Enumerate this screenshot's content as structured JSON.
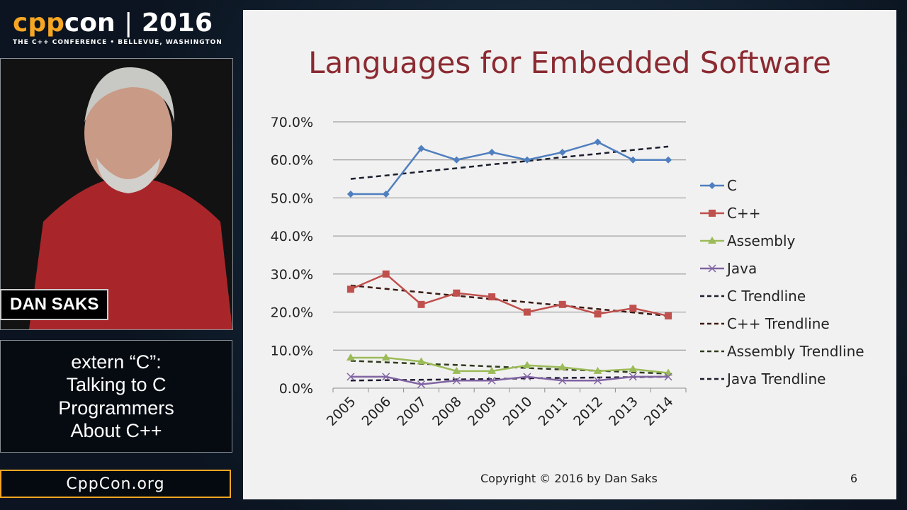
{
  "branding": {
    "logo_cpp": "cpp",
    "logo_con": "con",
    "logo_sep": "|",
    "logo_year": "2016",
    "tagline": "THE C++ CONFERENCE • BELLEVUE, WASHINGTON",
    "site": "CppCon.org"
  },
  "speaker": {
    "name": "DAN SAKS"
  },
  "talk": {
    "title_lines": [
      "extern “C”:",
      "Talking to C",
      "Programmers",
      "About C++"
    ]
  },
  "slide": {
    "title": "Languages for Embedded Software",
    "copyright": "Copyright © 2016 by Dan Saks",
    "page": "6"
  },
  "chart_data": {
    "type": "line",
    "title": "Languages for Embedded Software",
    "x": [
      "2005",
      "2006",
      "2007",
      "2008",
      "2009",
      "2010",
      "2011",
      "2012",
      "2013",
      "2014"
    ],
    "ylim": [
      0,
      70
    ],
    "yticks": [
      "0.0%",
      "10.0%",
      "20.0%",
      "30.0%",
      "40.0%",
      "50.0%",
      "60.0%",
      "70.0%"
    ],
    "grid": true,
    "legend": "right",
    "series": [
      {
        "name": "C",
        "color": "#4f7fbf",
        "marker": "diamond",
        "values": [
          51,
          51,
          63,
          60,
          62,
          60,
          62,
          64.7,
          60,
          60
        ]
      },
      {
        "name": "C++",
        "color": "#c0504d",
        "marker": "square",
        "values": [
          26,
          30,
          22,
          25,
          24,
          20,
          22,
          19.5,
          21,
          19
        ]
      },
      {
        "name": "Assembly",
        "color": "#9bbb59",
        "marker": "triangle",
        "values": [
          8,
          8,
          7,
          4.5,
          4.5,
          6,
          5.5,
          4.5,
          5,
          4
        ]
      },
      {
        "name": "Java",
        "color": "#8064a2",
        "marker": "x",
        "values": [
          3,
          3,
          1,
          2,
          2,
          3,
          2,
          2,
          3,
          3
        ]
      },
      {
        "name": "C Trendline",
        "color": "#1a1f2e",
        "dashed": true,
        "values": [
          55,
          55.9,
          56.9,
          57.8,
          58.8,
          59.7,
          60.7,
          61.6,
          62.6,
          63.5
        ]
      },
      {
        "name": "C++ Trendline",
        "color": "#3a1a12",
        "dashed": true,
        "values": [
          27,
          26.1,
          25.2,
          24.3,
          23.4,
          22.6,
          21.7,
          20.8,
          19.9,
          19
        ]
      },
      {
        "name": "Assembly Trendline",
        "color": "#2e3a1e",
        "dashed": true,
        "values": [
          7.2,
          6.8,
          6.4,
          6.1,
          5.7,
          5.3,
          4.9,
          4.6,
          4.2,
          3.8
        ]
      },
      {
        "name": "Java Trendline",
        "color": "#1e1a30",
        "dashed": true,
        "values": [
          2,
          2.1,
          2.2,
          2.3,
          2.4,
          2.6,
          2.7,
          2.8,
          2.9,
          3
        ]
      }
    ]
  }
}
